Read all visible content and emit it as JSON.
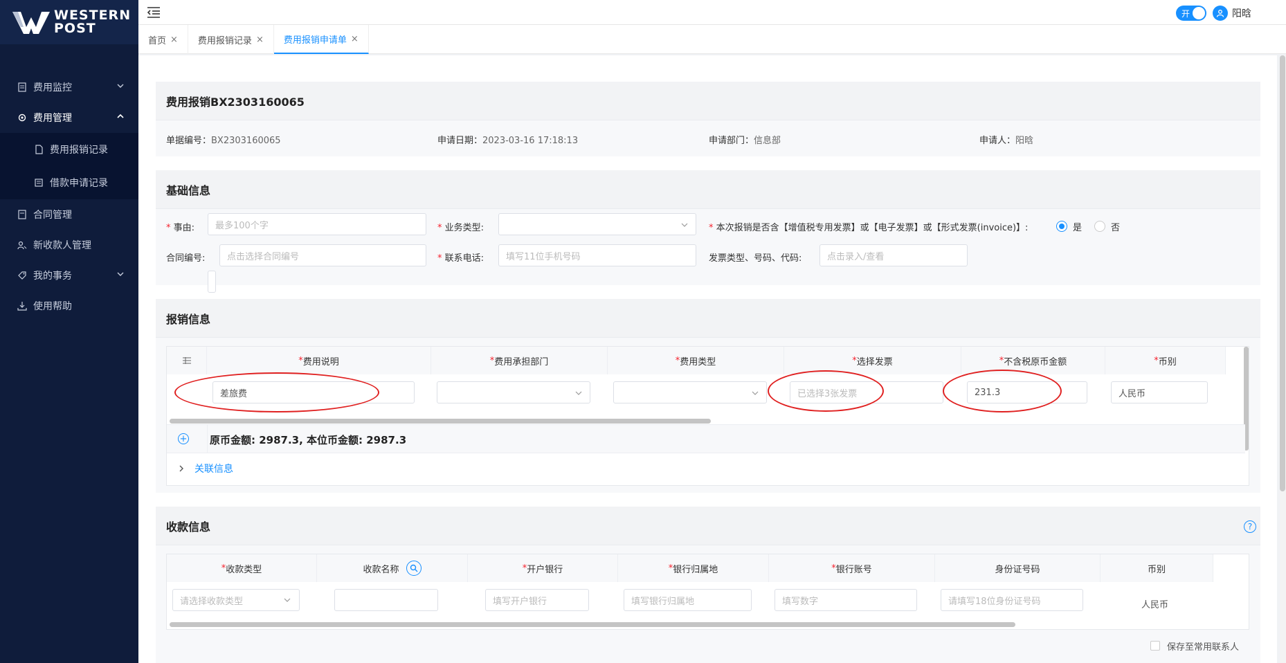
{
  "app": {
    "logo_line1": "WESTERN",
    "logo_line2": "POST"
  },
  "sidebar": {
    "items": [
      {
        "label": "费用监控",
        "icon": "monitor-doc-icon"
      },
      {
        "label": "费用管理",
        "icon": "gear-icon"
      },
      {
        "label": "费用报销记录",
        "icon": "file-icon"
      },
      {
        "label": "借款申请记录",
        "icon": "list-icon"
      },
      {
        "label": "合同管理",
        "icon": "contract-icon"
      },
      {
        "label": "新收款人管理",
        "icon": "users-icon"
      },
      {
        "label": "我的事务",
        "icon": "tag-icon"
      },
      {
        "label": "使用帮助",
        "icon": "download-icon"
      }
    ]
  },
  "topbar": {
    "toggle_label": "开",
    "user_name": "阳晗"
  },
  "tabs": [
    {
      "label": "首页",
      "close": "×"
    },
    {
      "label": "费用报销记录",
      "close": "×"
    },
    {
      "label": "费用报销申请单",
      "close": "×"
    }
  ],
  "header_card": {
    "title": "费用报销BX2303160065",
    "fields": [
      {
        "label": "单据编号：",
        "value": "BX2303160065"
      },
      {
        "label": "申请日期：",
        "value": "2023-03-16 17:18:13"
      },
      {
        "label": "申请部门：",
        "value": "信息部"
      },
      {
        "label": "申请人：",
        "value": "阳晗"
      }
    ]
  },
  "basic": {
    "title": "基础信息",
    "reason_label": "事由:",
    "reason_placeholder": "最多100个字",
    "biz_type_label": "业务类型:",
    "invoice_question": "本次报销是否含【增值税专用发票】或【电子发票】或【形式发票(invoice)】:",
    "yes": "是",
    "no": "否",
    "contract_label": "合同编号:",
    "contract_placeholder": "点击选择合同编号",
    "phone_label": "联系电话:",
    "phone_placeholder": "填写11位手机号码",
    "invoice_info_label": "发票类型、号码、代码:",
    "invoice_info_placeholder": "点击录入/查看"
  },
  "reimb": {
    "title": "报销信息",
    "columns": [
      "费用说明",
      "费用承担部门",
      "费用类型",
      "选择发票",
      "不含税原币金额",
      "币别"
    ],
    "row": {
      "desc": "差旅费",
      "invoice": "已选择3张发票",
      "amount": "231.3",
      "currency": "人民币"
    },
    "total": "原币金额: 2987.3, 本位币金额: 2987.3",
    "related": "关联信息"
  },
  "payee": {
    "title": "收款信息",
    "columns": [
      "收款类型",
      "收款名称",
      "开户银行",
      "银行归属地",
      "银行账号",
      "身份证号码",
      "币别"
    ],
    "required": [
      true,
      false,
      true,
      true,
      true,
      false,
      false
    ],
    "placeholders": {
      "type": "请选择收款类型",
      "bank": "填写开户银行",
      "location": "填写银行归属地",
      "account": "填写数字",
      "id": "请填写18位身份证号码"
    },
    "currency": "人民币",
    "save_contact": "保存至常用联系人"
  },
  "colors": {
    "sidebar_bg": "#0f1c3b",
    "accent": "#1890ff",
    "required": "#f5222d",
    "annotation": "#e02020"
  }
}
